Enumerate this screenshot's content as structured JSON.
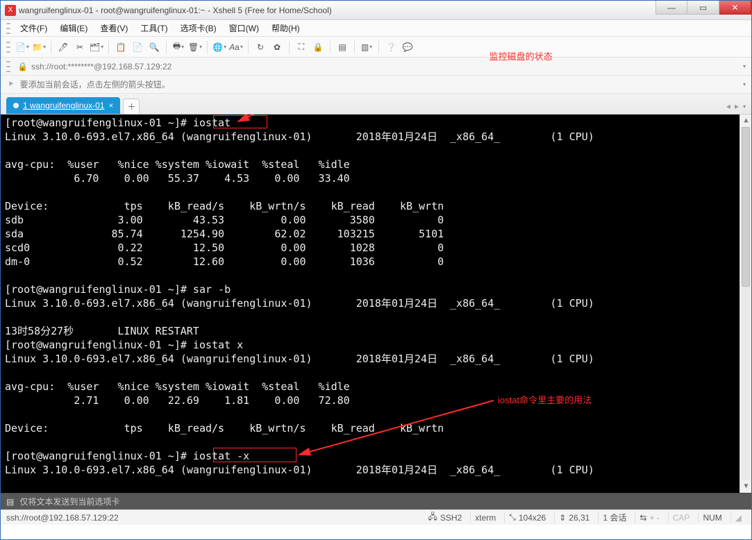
{
  "window": {
    "title": "wangruifenglinux-01 - root@wangruifenglinux-01:~ - Xshell 5 (Free for Home/School)"
  },
  "menus": {
    "file": "文件(F)",
    "edit": "编辑(E)",
    "view": "查看(V)",
    "tools": "工具(T)",
    "tabs": "选项卡(B)",
    "window": "窗口(W)",
    "help": "帮助(H)"
  },
  "address": "ssh://root:********@192.168.57.129:22",
  "info_hint": "要添加当前会话，点击左侧的箭头按钮。",
  "tab": {
    "label": "1 wangruifenglinux-01"
  },
  "annotations": {
    "a1": "监控磁盘的状态",
    "a2": "iostat命令里主要的用法"
  },
  "terminal_lines": [
    "[root@wangruifenglinux-01 ~]# iostat ",
    "Linux 3.10.0-693.el7.x86_64 (wangruifenglinux-01)       2018年01月24日  _x86_64_        (1 CPU)",
    "",
    "avg-cpu:  %user   %nice %system %iowait  %steal   %idle",
    "           6.70    0.00   55.37    4.53    0.00   33.40",
    "",
    "Device:            tps    kB_read/s    kB_wrtn/s    kB_read    kB_wrtn",
    "sdb               3.00        43.53         0.00       3580          0",
    "sda              85.74      1254.90        62.02     103215       5101",
    "scd0              0.22        12.50         0.00       1028          0",
    "dm-0              0.52        12.60         0.00       1036          0",
    "",
    "[root@wangruifenglinux-01 ~]# sar -b",
    "Linux 3.10.0-693.el7.x86_64 (wangruifenglinux-01)       2018年01月24日  _x86_64_        (1 CPU)",
    "",
    "13时58分27秒       LINUX RESTART",
    "[root@wangruifenglinux-01 ~]# iostat x",
    "Linux 3.10.0-693.el7.x86_64 (wangruifenglinux-01)       2018年01月24日  _x86_64_        (1 CPU)",
    "",
    "avg-cpu:  %user   %nice %system %iowait  %steal   %idle",
    "           2.71    0.00   22.69    1.81    0.00   72.80",
    "",
    "Device:            tps    kB_read/s    kB_wrtn/s    kB_read    kB_wrtn",
    "",
    "[root@wangruifenglinux-01 ~]# iostat -x ",
    "Linux 3.10.0-693.el7.x86_64 (wangruifenglinux-01)       2018年01月24日  _x86_64_        (1 CPU)",
    ""
  ],
  "sendbar": "仅将文本发送到当前选项卡",
  "status": {
    "left": "ssh://root@192.168.57.129:22",
    "ssh": "SSH2",
    "term": "xterm",
    "size": "104x26",
    "pos_icon": "⇕",
    "pos": "26,31",
    "sess": "1 会话",
    "chev_icon": "↔",
    "chev": "←  →",
    "cap": "CAP",
    "num": "NUM"
  }
}
